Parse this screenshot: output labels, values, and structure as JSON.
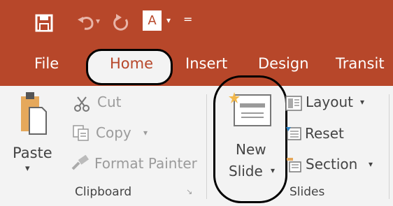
{
  "quick_access": {
    "font_button": "A",
    "dropdown_glyph": "▾",
    "customize_glyph": "="
  },
  "tabs": [
    "File",
    "Home",
    "Insert",
    "Design",
    "Transit"
  ],
  "clipboard": {
    "paste": "Paste",
    "paste_arrow": "▾",
    "cut": "Cut",
    "copy": "Copy",
    "copy_arrow": "▾",
    "format_painter": "Format Painter",
    "group_label": "Clipboard",
    "launcher": "↘"
  },
  "slides": {
    "new": "New",
    "slide": "Slide",
    "slide_arrow": "▾",
    "layout": "Layout",
    "layout_arrow": "▾",
    "reset": "Reset",
    "section": "Section",
    "section_arrow": "▾",
    "group_label": "Slides"
  },
  "colors": {
    "accent": "#b7472a",
    "ribbon": "#f3f3f3"
  }
}
